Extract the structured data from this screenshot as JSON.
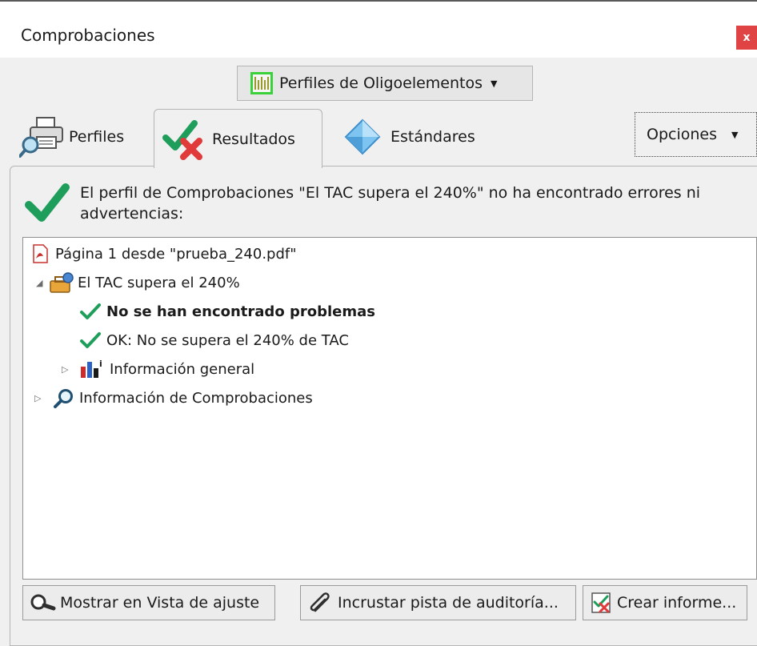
{
  "window": {
    "title": "Comprobaciones",
    "close_label": "x"
  },
  "profile_dropdown": {
    "label": "Perfiles de Oligoelementos"
  },
  "tabs": [
    {
      "label": "Perfiles",
      "icon": "printer-magnifier-icon"
    },
    {
      "label": "Resultados",
      "icon": "check-cross-icon",
      "active": true
    },
    {
      "label": "Estándares",
      "icon": "diamond-icon"
    }
  ],
  "options_button": {
    "label": "Opciones"
  },
  "summary": {
    "text": "El perfil de Comprobaciones \"El TAC supera el 240%\" no ha encontrado errores ni advertencias:"
  },
  "tree": {
    "file_label": "Página 1 desde \"prueba_240.pdf\"",
    "profile_label": "El TAC supera el 240%",
    "no_problems_label": "No se han encontrado problemas",
    "ok_label": "OK: No se supera el 240% de TAC",
    "general_info_label": "Información general",
    "checks_info_label": "Información de Comprobaciones"
  },
  "buttons": {
    "show_fixup_view": "Mostrar en Vista de ajuste",
    "embed_audit_trail": "Incrustar pista de auditoría...",
    "create_report": "Crear informe..."
  },
  "colors": {
    "accent_green": "#1e9e5a",
    "close_red": "#e04343",
    "error_red": "#e03a3a"
  }
}
